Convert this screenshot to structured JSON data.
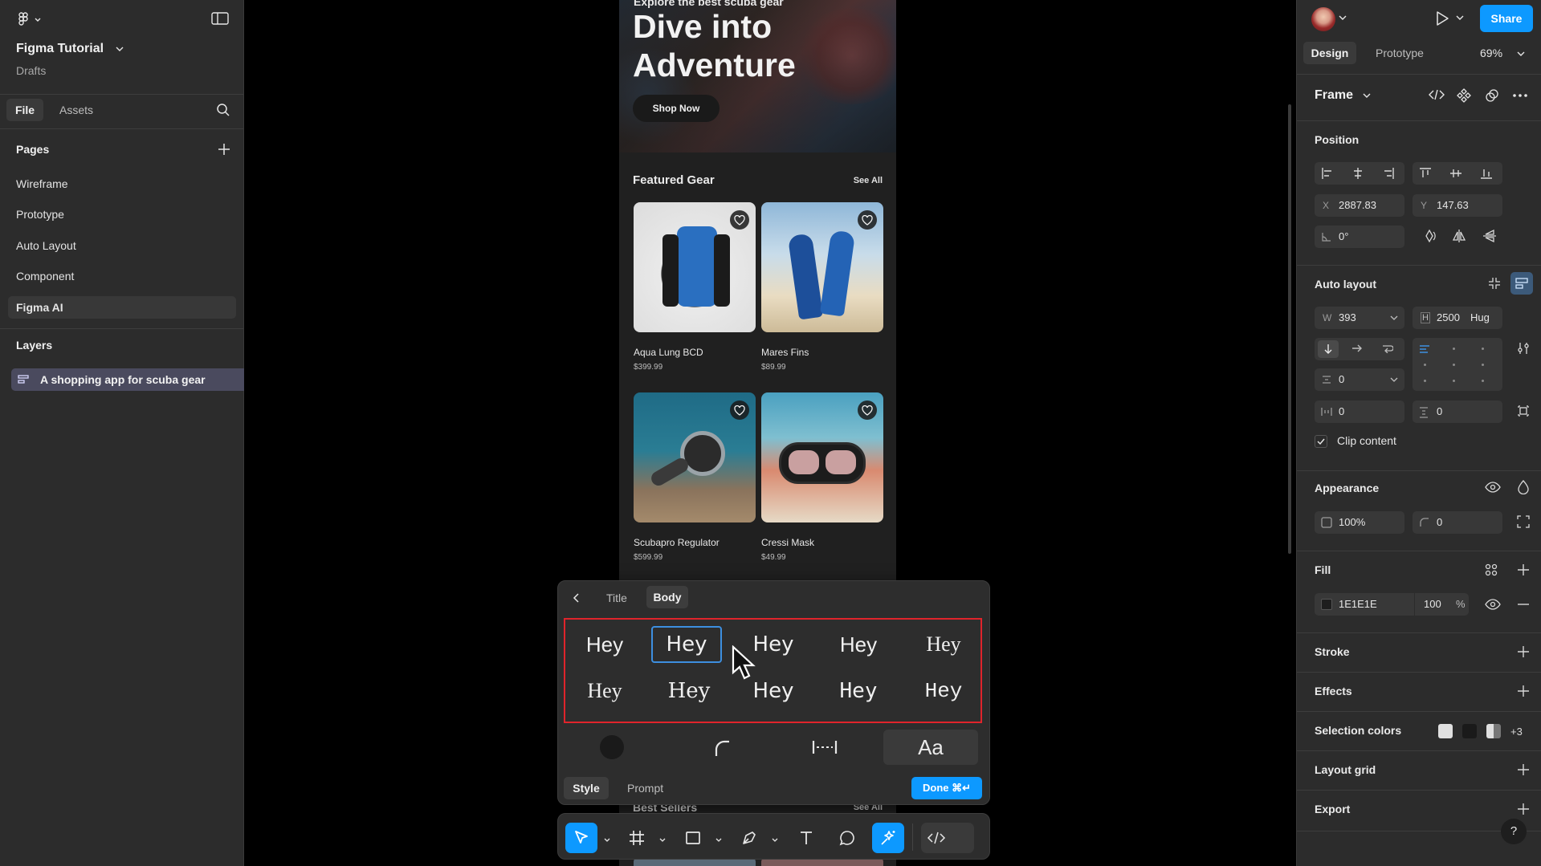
{
  "left": {
    "file_title": "Figma Tutorial",
    "file_location": "Drafts",
    "tabs": [
      "File",
      "Assets"
    ],
    "pages_heading": "Pages",
    "pages": [
      "Wireframe",
      "Prototype",
      "Auto Layout",
      "Component",
      "Figma AI"
    ],
    "selected_page": "Figma AI",
    "layers_heading": "Layers",
    "layer": "A shopping app for scuba gear"
  },
  "frame": {
    "hero_kicker": "Explore the best scuba gear",
    "hero_title_line1": "Dive into",
    "hero_title_line2": "Adventure",
    "shop_now": "Shop Now",
    "featured_heading": "Featured Gear",
    "see_all": "See All",
    "products": [
      {
        "name": "Aqua Lung BCD",
        "price": "$399.99"
      },
      {
        "name": "Mares Fins",
        "price": "$89.99"
      },
      {
        "name": "Scubapro Regulator",
        "price": "$599.99"
      },
      {
        "name": "Cressi Mask",
        "price": "$49.99"
      }
    ],
    "best_sellers_heading": "Best Sellers",
    "best_sellers_see_all": "See All"
  },
  "popup": {
    "tabs": [
      "Title",
      "Body"
    ],
    "active_tab": "Body",
    "samples_row1": [
      "Hey",
      "Hey",
      "Hey",
      "Hey",
      "Hey"
    ],
    "samples_row2": [
      "Hey",
      "Hey",
      "Hey",
      "Hey",
      "Hey"
    ],
    "selected_sample": "row1-2",
    "typography_label": "Aa",
    "style_tab": "Style",
    "prompt_tab": "Prompt",
    "done_label": "Done ⌘↵"
  },
  "right": {
    "share_label": "Share",
    "tabs": [
      "Design",
      "Prototype"
    ],
    "zoom": "69%",
    "frame_label": "Frame",
    "position_heading": "Position",
    "x_label": "X",
    "x_value": "2887.83",
    "y_label": "Y",
    "y_value": "147.63",
    "rotation": "0°",
    "auto_layout_heading": "Auto layout",
    "w_label": "W",
    "w_value": "393",
    "h_label": "H",
    "h_value": "2500",
    "h_mode": "Hug",
    "gap_value": "0",
    "padding_h": "0",
    "padding_v": "0",
    "clip_content": "Clip content",
    "appearance_heading": "Appearance",
    "opacity": "100%",
    "radius": "0",
    "fill_heading": "Fill",
    "fill_hex": "1E1E1E",
    "fill_opacity": "100",
    "fill_pct": "%",
    "stroke_heading": "Stroke",
    "effects_heading": "Effects",
    "selection_colors_heading": "Selection colors",
    "selection_more": "+3",
    "layout_grid_heading": "Layout grid",
    "export_heading": "Export",
    "help": "?"
  },
  "colors": {
    "accent": "#0d99ff",
    "highlight": "#e0242b",
    "panel": "#2c2c2c",
    "frame_fill": "#1E1E1E"
  }
}
